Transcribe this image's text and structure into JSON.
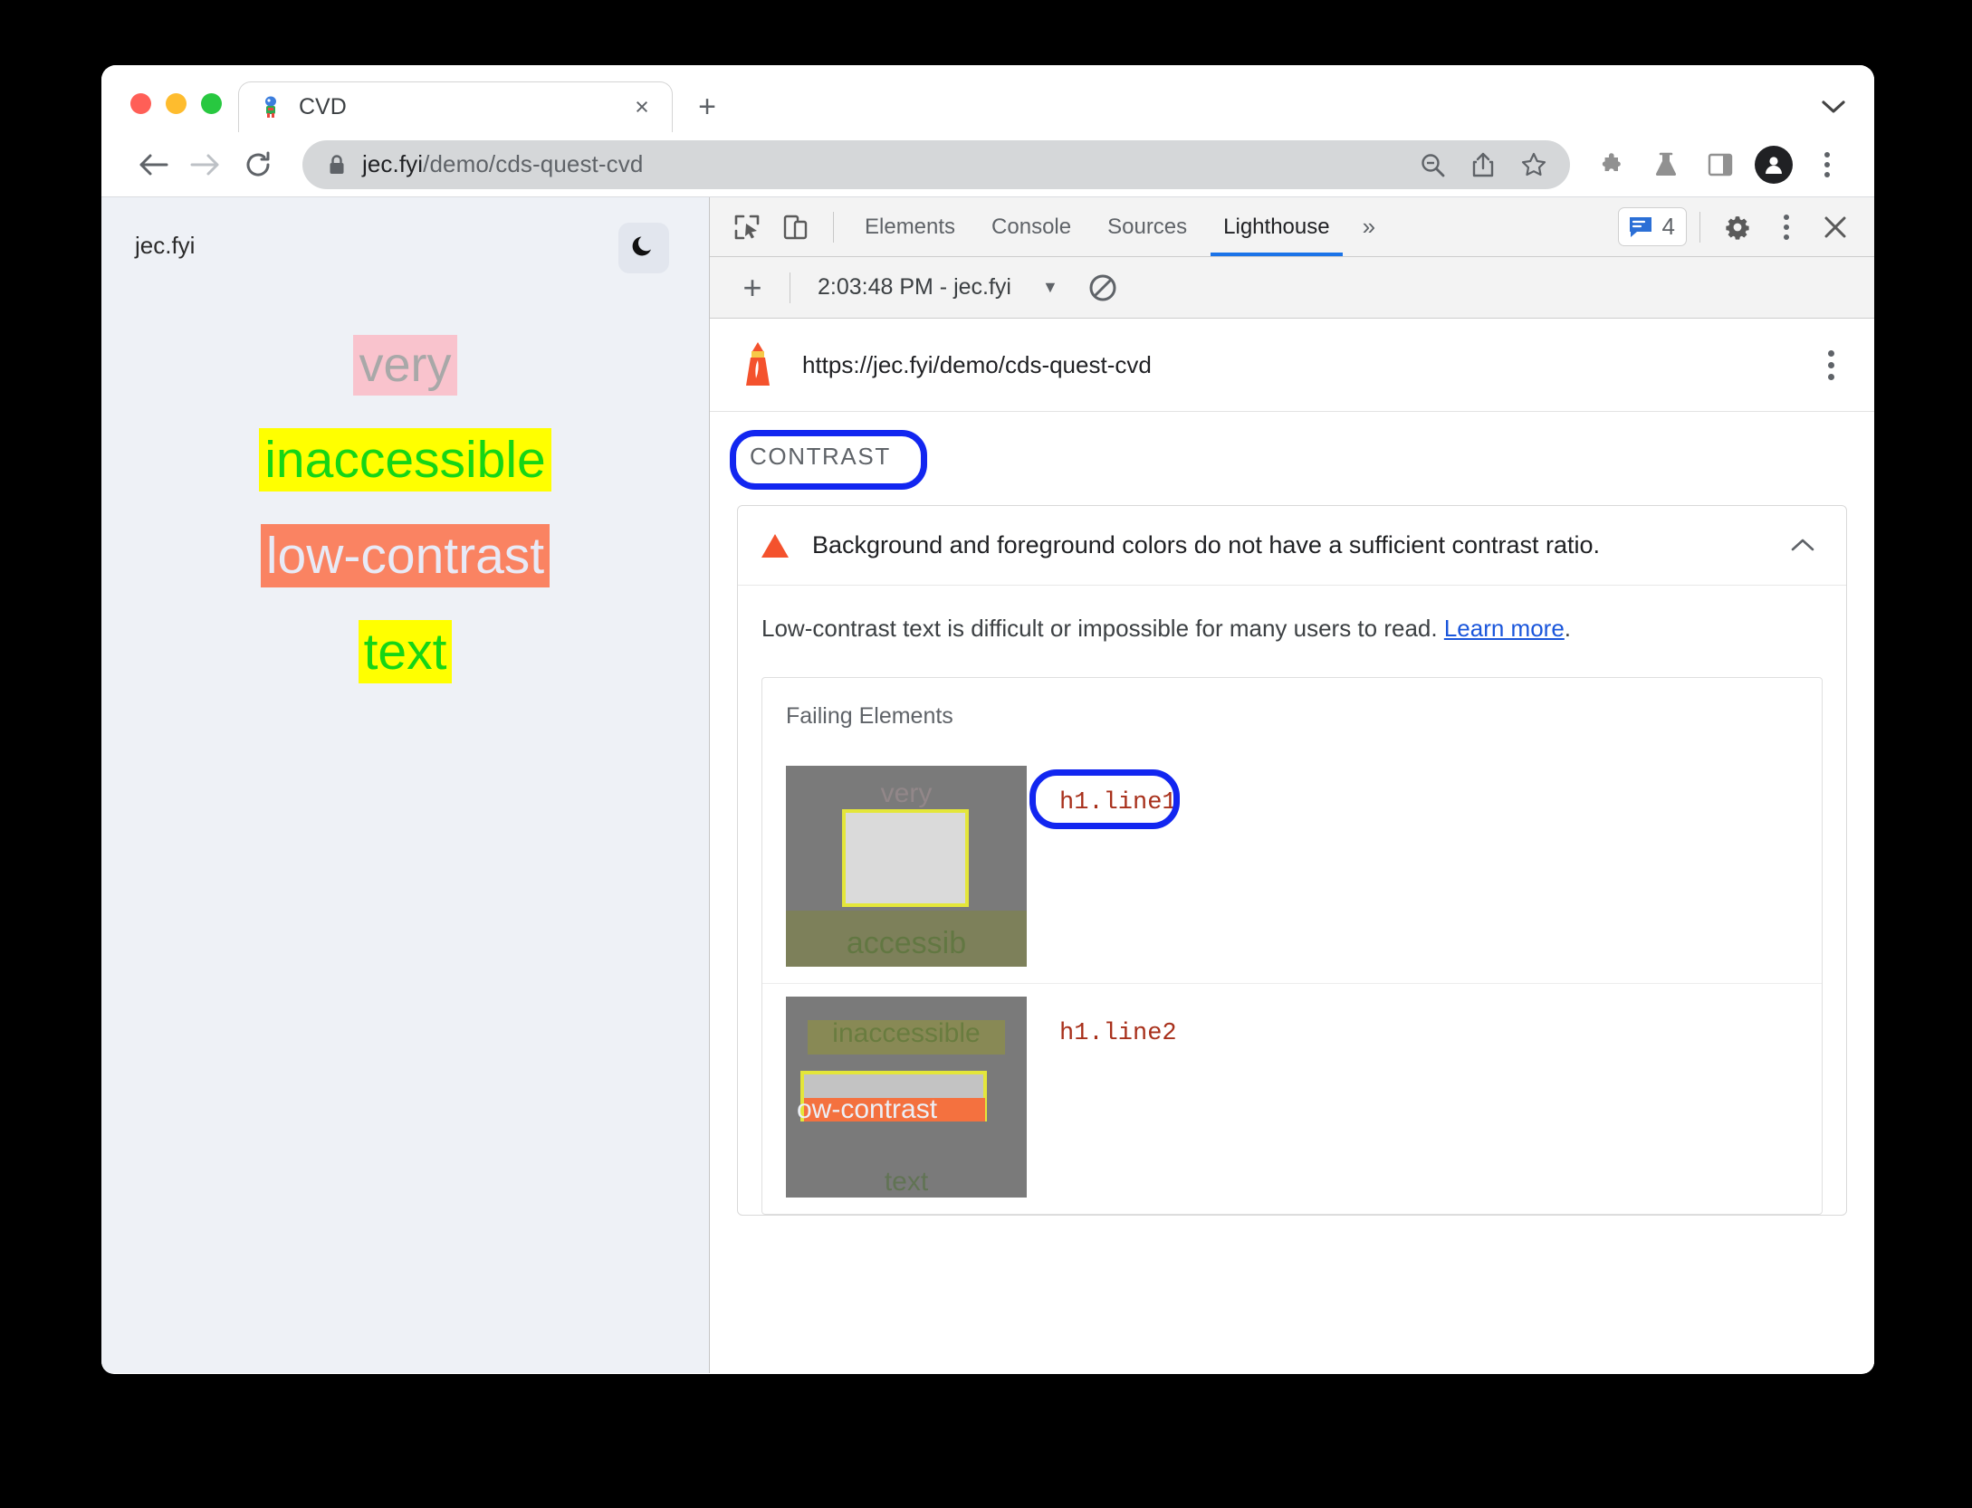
{
  "browser": {
    "tab": {
      "title": "CVD",
      "favicon": "chrome-dino-favicon",
      "close_label": "×"
    },
    "new_tab_label": "+",
    "tab_search_icon": "chevron-down-icon",
    "toolbar": {
      "back_icon": "arrow-back-icon",
      "forward_icon": "arrow-forward-icon",
      "reload_icon": "reload-icon",
      "lock_icon": "lock-icon",
      "url_host": "jec.fyi",
      "url_path": "/demo/cds-quest-cvd",
      "actions": [
        "zoom-out-icon",
        "share-icon",
        "bookmark-star-icon"
      ],
      "right_actions": [
        "extensions-puzzle-icon",
        "experiments-flask-icon",
        "side-panel-icon",
        "profile-avatar",
        "chrome-menu-kebab-icon"
      ]
    }
  },
  "page": {
    "site_name": "jec.fyi",
    "theme_toggle_icon": "moon-icon",
    "lines": [
      {
        "text": "very",
        "fg": "#a8a8a8",
        "bg": "#f9c3cd"
      },
      {
        "text": "inaccessible",
        "fg": "#15d615",
        "bg": "#ffff00"
      },
      {
        "text": "low-contrast",
        "fg": "#e8eaf6",
        "bg": "#fa8362"
      },
      {
        "text": "text",
        "fg": "#15d615",
        "bg": "#ffff00"
      }
    ]
  },
  "devtools": {
    "inspect_icon": "inspect-cursor-icon",
    "device_icon": "device-toolbar-icon",
    "tabs": [
      {
        "label": "Elements",
        "active": false
      },
      {
        "label": "Console",
        "active": false
      },
      {
        "label": "Sources",
        "active": false
      },
      {
        "label": "Lighthouse",
        "active": true
      }
    ],
    "more_tabs_label": "»",
    "message_badge": {
      "icon": "message-icon",
      "count": "4"
    },
    "settings_icon": "gear-icon",
    "menu_icon": "kebab-menu-icon",
    "close_icon": "close-icon",
    "subbar": {
      "add_label": "+",
      "run_label": "2:03:48 PM - jec.fyi",
      "dropdown_icon": "caret-down-icon",
      "clear_icon": "no-entry-clear-icon"
    }
  },
  "report": {
    "lighthouse_icon": "lighthouse-icon",
    "url": "https://jec.fyi/demo/cds-quest-cvd",
    "kebab_icon": "kebab-menu-icon",
    "section_label": "CONTRAST",
    "audit": {
      "warning_icon": "warning-triangle-icon",
      "title": "Background and foreground colors do not have a sufficient contrast ratio.",
      "collapse_icon": "chevron-up-icon",
      "description_before": "Low-contrast text is difficult or impossible for many users to read. ",
      "link_text": "Learn more",
      "description_after": ".",
      "failing_title": "Failing Elements",
      "rows": [
        {
          "selector": "h1.line1",
          "annotated": true,
          "thumb": {
            "top_text": "very",
            "top_color": "#a89a9a",
            "bottom_text": "accessib",
            "bottom_color": "#4e7a2e",
            "bottom_band": "#80853f"
          }
        },
        {
          "selector": "h1.line2",
          "annotated": false,
          "thumb": {
            "top_text": "inaccessible",
            "top_color": "#4e7a2e",
            "mid_text": "ow-contrast",
            "bottom_text": "text",
            "bottom_color": "#4e7a2e"
          }
        }
      ]
    }
  },
  "annotation_color": "#1226f0"
}
